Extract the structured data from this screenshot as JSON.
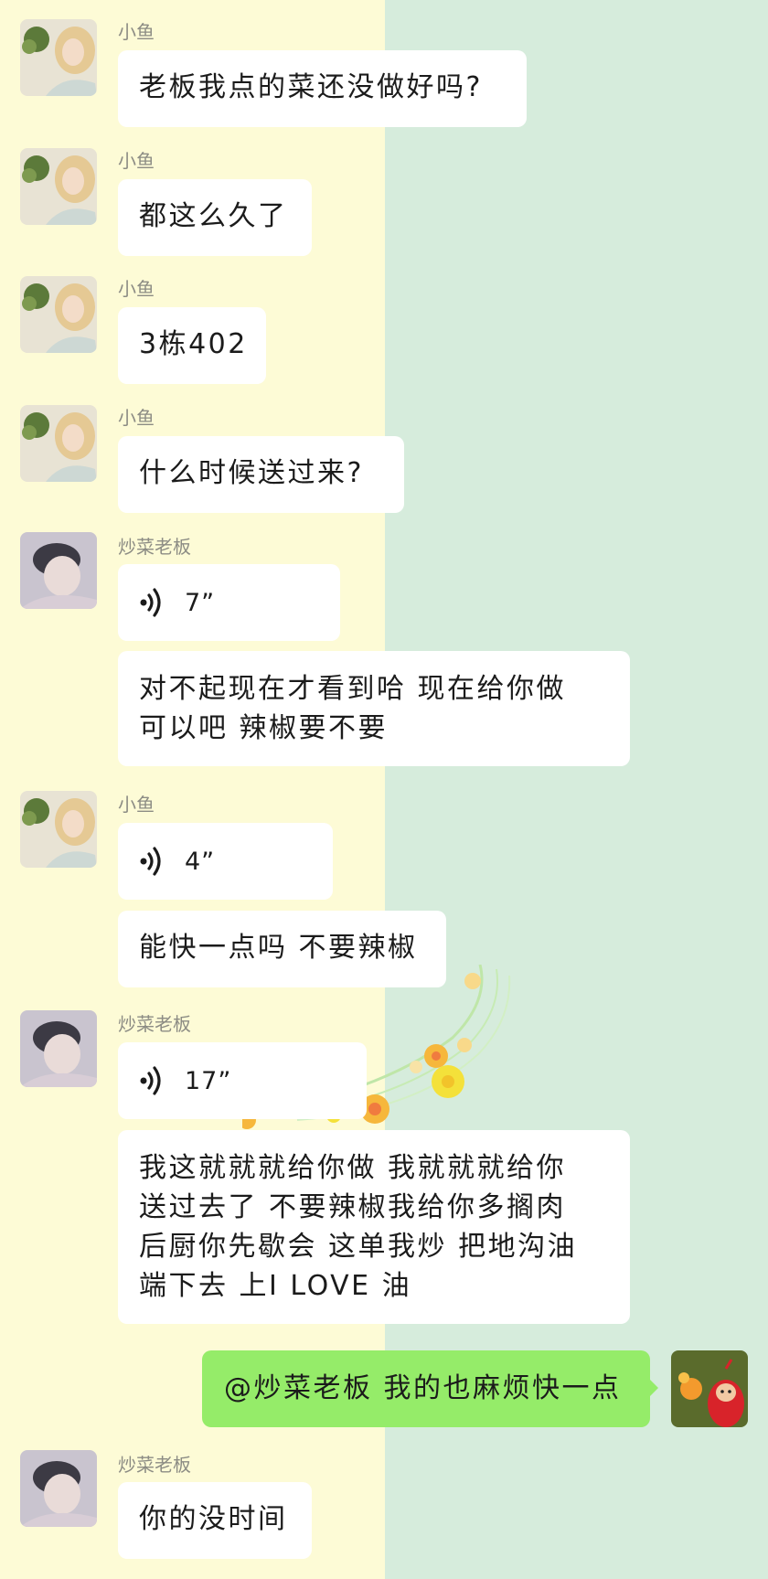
{
  "users": {
    "xiaoyu": "小鱼",
    "boss": "炒菜老板"
  },
  "messages": {
    "m1": "老板我点的菜还没做好吗?",
    "m2": "都这么久了",
    "m3": "3栋402",
    "m4": "什么时候送过来?",
    "m5_voice": "7”",
    "m6_line1": "对不起现在才看到哈 现在给你做",
    "m6_line2": "可以吧 辣椒要不要",
    "m7_voice": "4”",
    "m8": "能快一点吗 不要辣椒",
    "m9_voice": "17”",
    "m10_line1": "我这就就就给你做 我就就就给你",
    "m10_line2": "送过去了 不要辣椒我给你多搁肉",
    "m10_line3": "后厨你先歇会 这单我炒 把地沟油",
    "m10_line4": "端下去 上I LOVE 油",
    "m11": "@炒菜老板 我的也麻烦快一点",
    "m12": "你的没时间"
  },
  "colors": {
    "left_bg": "#fdfbd6",
    "right_bg": "#d6ecdc",
    "outgoing_bubble": "#95ec69",
    "incoming_bubble": "#ffffff",
    "name_text": "#8c8c84"
  },
  "icons": {
    "voice": "voice-wave-icon"
  }
}
